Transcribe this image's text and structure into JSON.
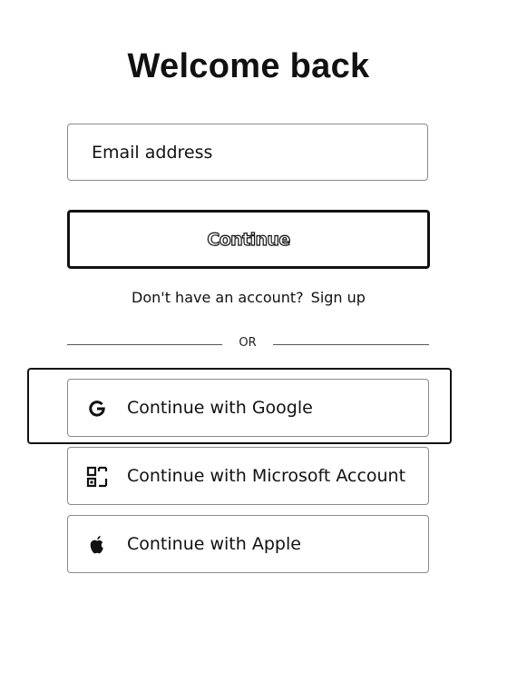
{
  "page": {
    "title": "Welcome back"
  },
  "email": {
    "placeholder": "Email address"
  },
  "continue_label": "Continue",
  "signup": {
    "prompt": "Don't have an account?",
    "link": "Sign up"
  },
  "divider": {
    "label": "OR"
  },
  "sso": [
    {
      "label": "Continue with Google",
      "icon": "google-icon"
    },
    {
      "label": "Continue with Microsoft Account",
      "icon": "microsoft-icon"
    },
    {
      "label": "Continue with Apple",
      "icon": "apple-icon"
    }
  ],
  "colors": {
    "text": "#111111",
    "border": "#8a8a8a",
    "background": "#ffffff"
  }
}
